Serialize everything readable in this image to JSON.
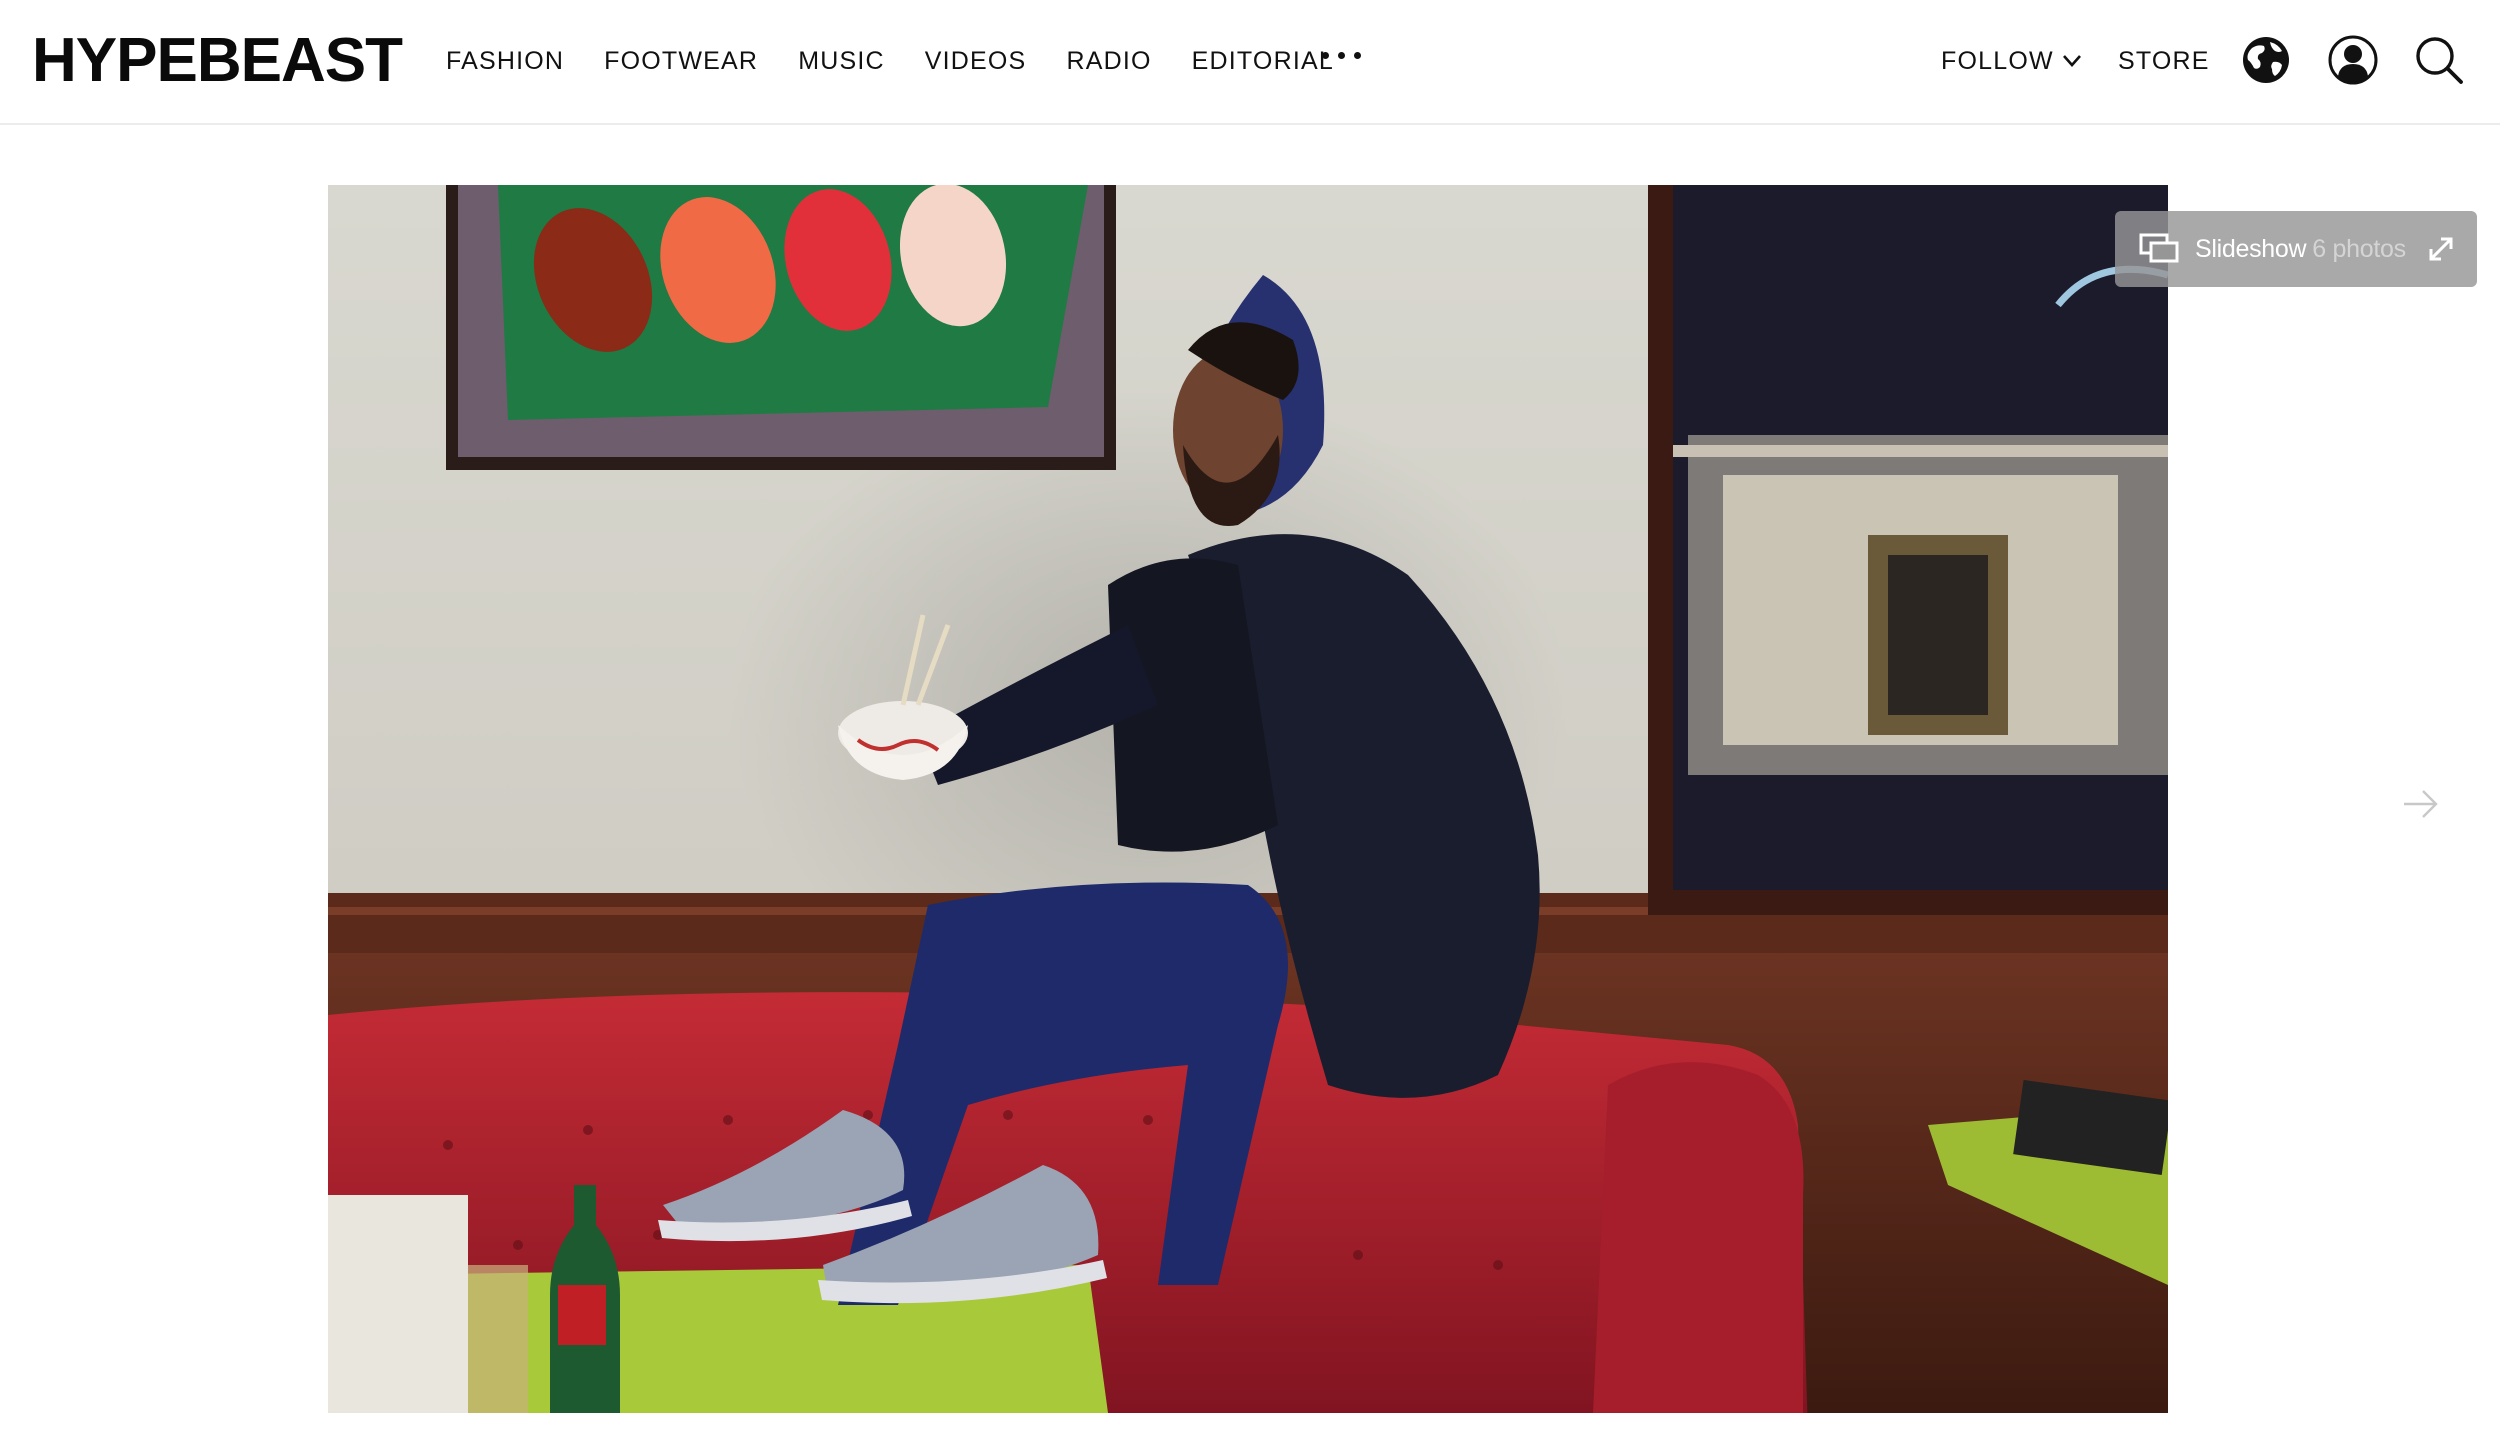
{
  "brand": {
    "logo_text": "HYPEBEAST"
  },
  "nav": {
    "items": [
      {
        "label": "FASHION"
      },
      {
        "label": "FOOTWEAR"
      },
      {
        "label": "MUSIC"
      },
      {
        "label": "VIDEOS"
      },
      {
        "label": "RADIO"
      },
      {
        "label": "EDITORIAL"
      }
    ],
    "more_icon": "ellipsis-icon"
  },
  "right_nav": {
    "follow_label": "FOLLOW",
    "follow_icon": "chevron-down-icon",
    "store_label": "STORE",
    "icons": [
      "globe-icon",
      "user-icon",
      "search-icon"
    ]
  },
  "gallery": {
    "slideshow_label": "Slideshow",
    "slideshow_count": "6 photos",
    "slideshow_icon": "slideshow-icon",
    "expand_icon": "expand-icon",
    "next_icon": "arrow-right-icon"
  },
  "colors": {
    "text": "#111111",
    "slideshow_bg": "#969696",
    "sofa_red": "#b8202e",
    "wall": "#d7d6cf",
    "wood": "#5a2a1c",
    "hoodie_navy": "#1f2750",
    "table_green": "#a9cc3a"
  }
}
